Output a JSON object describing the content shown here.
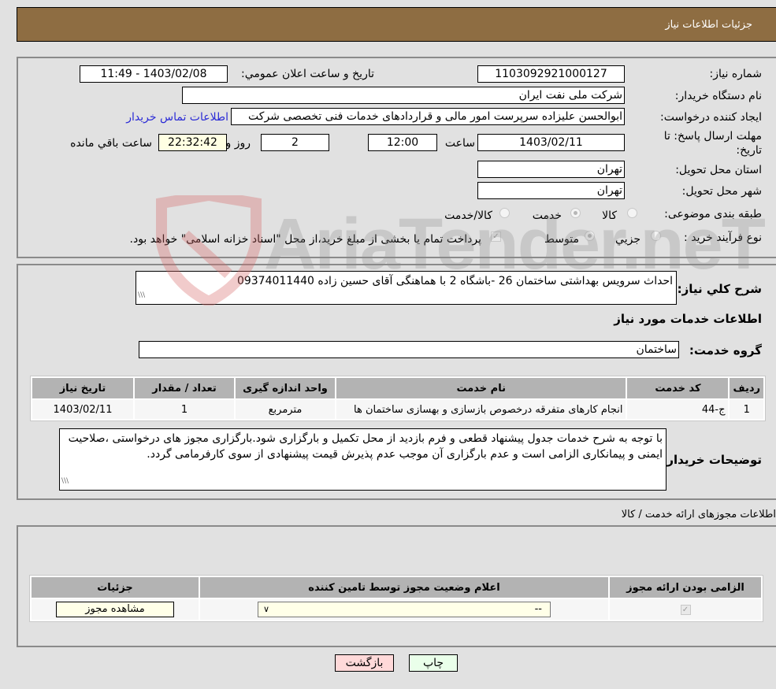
{
  "header": {
    "title": "جزئیات اطلاعات نیاز"
  },
  "details": {
    "need_number_label": "شماره نیاز:",
    "need_number": "1103092921000127",
    "announce_label": "تاریخ و ساعت اعلان عمومي:",
    "announce_value": "1403/02/08 - 11:49",
    "buyer_org_label": "نام دستگاه خریدار:",
    "buyer_org": "شرکت ملی نفت ایران",
    "creator_label": "ایجاد کننده درخواست:",
    "creator": "ابوالحسن علیزاده سرپرست امور مالی و قراردادهای خدمات فنی تخصصی شرکت",
    "contact_link": "اطلاعات تماس خریدار",
    "deadline_label_1": "مهلت ارسال پاسخ: تا",
    "deadline_label_2": "تاریخ:",
    "deadline_date": "1403/02/11",
    "time_label": "ساعت",
    "deadline_time": "12:00",
    "days_value": "2",
    "days_label": "روز و",
    "remaining_time": "22:32:42",
    "remaining_label": "ساعت باقي مانده",
    "province_label": "استان محل تحویل:",
    "province": "تهران",
    "city_label": "شهر محل تحویل:",
    "city": "تهران",
    "category_label": "طبقه بندی موضوعی:",
    "category_options": [
      {
        "label": "کالا",
        "selected": false
      },
      {
        "label": "خدمت",
        "selected": true
      },
      {
        "label": "کالا/خدمت",
        "selected": false
      }
    ],
    "purchase_type_label": "نوع فرآیند خرید :",
    "purchase_options": [
      {
        "label": "جزيي",
        "selected": false
      },
      {
        "label": "متوسط",
        "selected": true
      }
    ],
    "treasury_note": "پرداخت تمام یا بخشی از مبلغ خرید،از محل \"اسناد خزانه اسلامی\" خواهد بود.",
    "treasury_checked": true
  },
  "need": {
    "summary_label": "شرح کلي نیاز:",
    "summary": "احداث سرویس بهداشتی ساختمان 26 -باشگاه 2 با هماهنگی آقای حسین زاده 09374011440",
    "services_title": "اطلاعات خدمات مورد نیاز",
    "service_group_label": "گروه خدمت:",
    "service_group": "ساختمان"
  },
  "services_table": {
    "headers": [
      "ردیف",
      "کد خدمت",
      "نام خدمت",
      "واحد اندازه گیری",
      "تعداد / مقدار",
      "تاریخ نیاز"
    ],
    "rows": [
      [
        "1",
        "ج-44",
        "انجام کارهای متفرقه درخصوص بازسازی و بهسازی ساختمان ها",
        "مترمربع",
        "1",
        "1403/02/11"
      ]
    ]
  },
  "buyer_notes": {
    "label": "توضیحات خریدار:",
    "text": "با توجه به شرح خدمات جدول پیشنهاد قطعی و فرم بازدید از محل تکمیل و بارگزاری شود.بارگزاری مجوز های درخواستی ،صلاحیت ایمنی و پیمانکاری الزامی است و عدم بارگزاری آن موجب عدم پذیرش قیمت پیشنهادی  از سوی کارفرمامی گردد."
  },
  "permits": {
    "title": "اطلاعات مجوزهای ارائه خدمت / کالا",
    "headers": [
      "الزامی بودن ارائه مجوز",
      "اعلام وضعیت مجوز توسط تامین کننده",
      "جزئیات"
    ],
    "rows": [
      {
        "required": true,
        "status_selected": "--",
        "details_button": "مشاهده مجوز"
      }
    ]
  },
  "footer": {
    "print_button": "چاپ",
    "back_button": "بازگشت"
  },
  "watermark": {
    "text": "AriaTender.neT"
  },
  "colors": {
    "header_bg": "#8e6d42",
    "link": "#2b2bd6",
    "back_button_bg": "#ffd9d9",
    "print_button_bg": "#eaffea"
  }
}
